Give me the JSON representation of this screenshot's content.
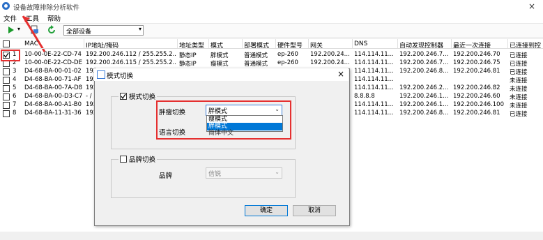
{
  "window": {
    "title": "设备故障排除分析软件",
    "close_glyph": "×"
  },
  "menu": [
    "文件",
    "工具",
    "帮助"
  ],
  "toolbar": {
    "combo_value": "全部设备"
  },
  "table": {
    "headers": [
      "MAC",
      "IP地址/掩码",
      "地址类型",
      "模式",
      "部署模式",
      "硬件型号",
      "网关",
      "DNS",
      "自动发现控制器",
      "最近一次连接",
      "已连接到控"
    ],
    "rows": [
      {
        "num": "1",
        "mac": "10-00-0E-22-CD-74",
        "ip": "192.200.246.112 / 255.255.2...",
        "type": "静态IP",
        "mode": "胖模式",
        "deploy": "普通模式",
        "hw": "ep-260",
        "gw": "192.200.24...",
        "dns": "114.114.11...",
        "ctrl": "192.200.246.7...",
        "last": "192.200.246.70",
        "conn": "已连接"
      },
      {
        "num": "2",
        "mac": "10-00-0E-22-CD-DE",
        "ip": "192.200.246.115 / 255.255.2...",
        "type": "静态IP",
        "mode": "瘦模式",
        "deploy": "普通模式",
        "hw": "ep-260",
        "gw": "192.200.24...",
        "dns": "114.114.11...",
        "ctrl": "192.200.246.7...",
        "last": "192.200.246.75",
        "conn": "已连接"
      },
      {
        "num": "3",
        "mac": "D4-68-BA-00-01-02",
        "ip": "192.",
        "type": "",
        "mode": "",
        "deploy": "",
        "hw": "",
        "gw": "",
        "dns": "114.114.11...",
        "ctrl": "192.200.246.8...",
        "last": "192.200.246.81",
        "conn": "已连接"
      },
      {
        "num": "4",
        "mac": "D4-68-BA-00-71-AF",
        "ip": "192.",
        "type": "",
        "mode": "",
        "deploy": "",
        "hw": "",
        "gw": "",
        "dns": "114.114.11...",
        "ctrl": "",
        "last": "",
        "conn": "未连接"
      },
      {
        "num": "5",
        "mac": "D4-68-BA-00-7A-D8",
        "ip": "192.",
        "type": "",
        "mode": "",
        "deploy": "",
        "hw": "",
        "gw": "",
        "dns": "114.114.11...",
        "ctrl": "192.200.246.2...",
        "last": "192.200.246.82",
        "conn": "未连接"
      },
      {
        "num": "6",
        "mac": "D4-68-BA-00-D3-C7",
        "ip": "- /",
        "type": "",
        "mode": "",
        "deploy": "",
        "hw": "",
        "gw": "",
        "dns": "8.8.8.8",
        "ctrl": "192.200.246.1...",
        "last": "192.200.246.60",
        "conn": "未连接"
      },
      {
        "num": "7",
        "mac": "D4-68-BA-00-A1-B0",
        "ip": "192.",
        "type": "",
        "mode": "",
        "deploy": "",
        "hw": "",
        "gw": "",
        "dns": "114.114.11...",
        "ctrl": "192.200.246.1...",
        "last": "192.200.246.100",
        "conn": "未连接"
      },
      {
        "num": "8",
        "mac": "D4-68-BA-11-31-36",
        "ip": "192.",
        "type": "",
        "mode": "",
        "deploy": "",
        "hw": "",
        "gw": "",
        "dns": "114.114.11...",
        "ctrl": "192.200.246.8...",
        "last": "192.200.246.81",
        "conn": "已连接"
      }
    ]
  },
  "dialog": {
    "title": "模式切换",
    "close_glyph": "×",
    "mode_group_label": "模式切换",
    "mode_switch_label": "胖瘦切换",
    "mode_value": "胖模式",
    "mode_options": [
      "瘦模式",
      "胖模式"
    ],
    "lang_label": "语言切换",
    "lang_value": "简体中文",
    "brand_group_label": "品牌切换",
    "brand_label": "品牌",
    "brand_value": "信锐",
    "ok": "确定",
    "cancel": "取消"
  }
}
